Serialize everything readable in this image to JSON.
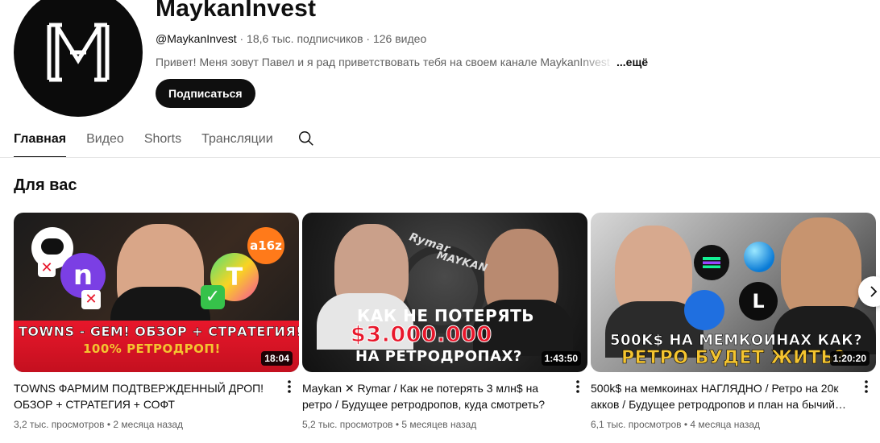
{
  "channel": {
    "name": "MaykanInvest",
    "handle": "@MaykanInvest",
    "subscribers": "18,6 тыс. подписчиков",
    "videos": "126 видео",
    "description": "Привет! Меня зовут Павел и я рад приветствовать тебя на своем канале MaykanInvest",
    "more_label": "...ещё",
    "subscribe_label": "Подписаться"
  },
  "tabs": [
    {
      "label": "Главная",
      "active": true
    },
    {
      "label": "Видео",
      "active": false
    },
    {
      "label": "Shorts",
      "active": false
    },
    {
      "label": "Трансляции",
      "active": false
    }
  ],
  "section": {
    "title": "Для вас"
  },
  "videos": [
    {
      "title": "TOWNS ФАРМИМ ПОДТВЕРЖДЕННЫЙ ДРОП! ОБЗОР + СТРАТЕГИЯ + СОФТ",
      "views": "3,2 тыс. просмотров",
      "age": "2 месяца назад",
      "duration": "18:04",
      "thumb_line1": "TOWNS - GEM! ОБЗОР + СТРАТЕГИЯ!",
      "thumb_line2": "100% РЕТРОДРОП!",
      "thumb_badge": "a16z"
    },
    {
      "title": "Maykan ✕ Rymar / Как не потерять 3 млн$ на ретро / Будущее ретродропов, куда смотреть?",
      "views": "5,2 тыс. просмотров",
      "age": "5 месяцев назад",
      "duration": "1:43:50",
      "thumb_line1": "КАК НЕ ПОТЕРЯТЬ",
      "thumb_line2": "$3.000.000",
      "thumb_line3": "НА РЕТРОДРОПАХ?",
      "thumb_name1": "Rymar",
      "thumb_name2": "Maykan"
    },
    {
      "title": "500k$ на мемкоинах НАГЛЯДНО / Ретро на 20к акков / Будущее ретродропов и план на бычий…",
      "views": "6,1 тыс. просмотров",
      "age": "4 месяца назад",
      "duration": "1:20:20",
      "thumb_line1": "500K$ НА МЕМКОИНАХ КАК?",
      "thumb_line2": "РЕТРО БУДЕТ ЖИТЬ?"
    }
  ],
  "colors": {
    "accent_red": "#e8172b",
    "gold": "#f4c430",
    "text_secondary": "#606060"
  }
}
